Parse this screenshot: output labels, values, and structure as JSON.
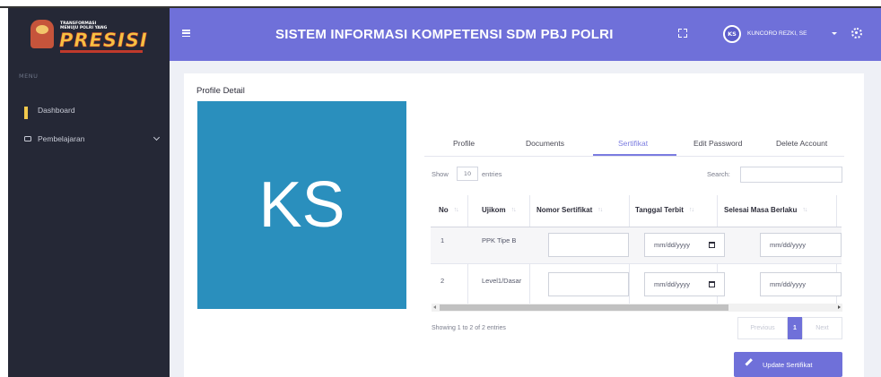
{
  "logo": {
    "tagline": "TRANSFORMASI\nMENUJU POLRI YANG",
    "brand": "PRESISI"
  },
  "sidebar": {
    "menu_header": "MENU",
    "items": [
      {
        "label": "Dashboard",
        "icon": "grid-icon"
      },
      {
        "label": "Pembelajaran",
        "icon": "monitor-icon"
      }
    ]
  },
  "header": {
    "title": "SISTEM INFORMASI KOMPETENSI SDM PBJ POLRI",
    "avatar_initials": "KS",
    "username": "KUNCORO REZKI, SE"
  },
  "profile": {
    "title": "Profile Detail",
    "initials": "KS"
  },
  "tabs": [
    {
      "label": "Profile"
    },
    {
      "label": "Documents"
    },
    {
      "label": "Sertifikat"
    },
    {
      "label": "Edit Password"
    },
    {
      "label": "Delete Account"
    }
  ],
  "table_controls": {
    "show_label": "Show",
    "entries_value": "10",
    "entries_label": "entries",
    "search_label": "Search:"
  },
  "table": {
    "headers": [
      "No",
      "Ujikom",
      "Nomor Sertifikat",
      "Tanggal Terbit",
      "Selesai Masa Berlaku"
    ],
    "rows": [
      {
        "no": "1",
        "ujikom": "PPK Tipe B",
        "tanggal": "mm/dd/yyyy",
        "selesai": "mm/dd/yyyy"
      },
      {
        "no": "2",
        "ujikom": "Level1/Dasar",
        "tanggal": "mm/dd/yyyy",
        "selesai": "mm/dd/yyyy"
      }
    ]
  },
  "footer": {
    "info": "Showing 1 to 2 of 2 entries",
    "previous": "Previous",
    "current_page": "1",
    "next": "Next",
    "update_button": "Update Sertifikat"
  },
  "colors": {
    "header_bg": "#6f70d9",
    "sidebar_bg": "#252836",
    "avatar_box": "#2a8fbd",
    "accent": "#7b7ce0"
  }
}
